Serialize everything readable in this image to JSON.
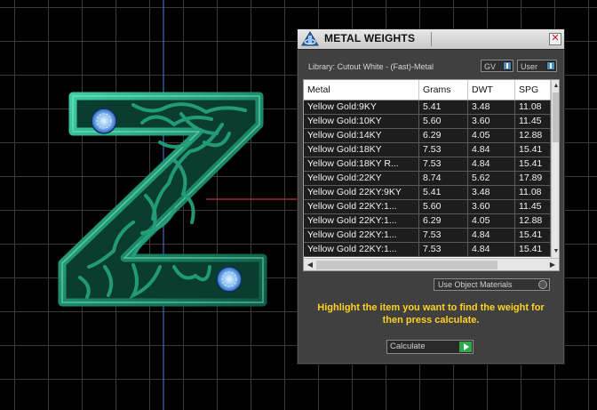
{
  "panel": {
    "title": "METAL WEIGHTS",
    "close_glyph": "✕",
    "library_label": "Library: Cutout White - (Fast)-Metal",
    "toggle_gv": "GV",
    "toggle_user": "User",
    "columns": [
      "Metal",
      "Grams",
      "DWT",
      "SPG"
    ],
    "rows": [
      [
        "Yellow Gold:9KY",
        "5.41",
        "3.48",
        "11.08"
      ],
      [
        "Yellow Gold:10KY",
        "5.60",
        "3.60",
        "11.45"
      ],
      [
        "Yellow Gold:14KY",
        "6.29",
        "4.05",
        "12.88"
      ],
      [
        "Yellow Gold:18KY",
        "7.53",
        "4.84",
        "15.41"
      ],
      [
        "Yellow Gold:18KY R...",
        "7.53",
        "4.84",
        "15.41"
      ],
      [
        "Yellow Gold:22KY",
        "8.74",
        "5.62",
        "17.89"
      ],
      [
        "Yellow Gold 22KY:9KY",
        "5.41",
        "3.48",
        "11.08"
      ],
      [
        "Yellow Gold 22KY:1...",
        "5.60",
        "3.60",
        "11.45"
      ],
      [
        "Yellow Gold 22KY:1...",
        "6.29",
        "4.05",
        "12.88"
      ],
      [
        "Yellow Gold 22KY:1...",
        "7.53",
        "4.84",
        "15.41"
      ],
      [
        "Yellow Gold 22KY:1...",
        "7.53",
        "4.84",
        "15.41"
      ]
    ],
    "use_object_materials": "Use Object Materials",
    "instruction": "Highlight the item you want to find the weight for then press calculate.",
    "calculate_label": "Calculate"
  },
  "icons": {
    "app": "metal-weights-app-icon",
    "close": "close-icon",
    "scroll_up": "scroll-up-icon",
    "scroll_down": "scroll-down-icon",
    "scroll_left": "scroll-left-icon",
    "scroll_right": "scroll-right-icon",
    "play": "play-icon"
  },
  "colors": {
    "model": "#1f9a78",
    "instruction_text": "#ffd21e",
    "calc_play": "#2fa84a",
    "toggle_indicator": "#4a8db8"
  }
}
